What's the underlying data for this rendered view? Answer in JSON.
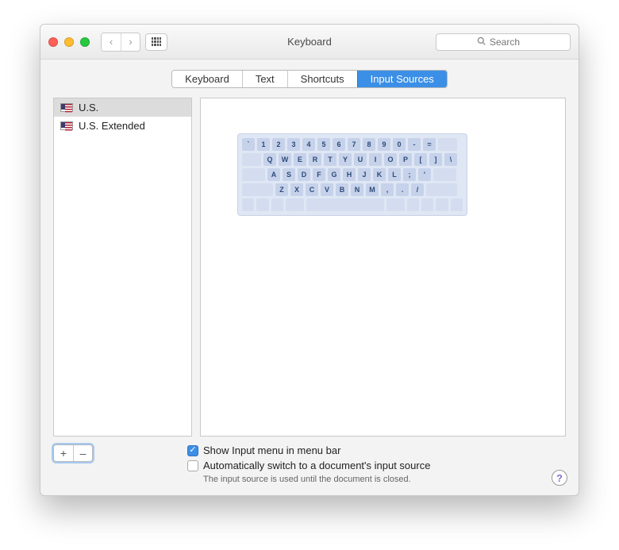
{
  "window": {
    "title": "Keyboard"
  },
  "search": {
    "placeholder": "Search"
  },
  "tabs": [
    {
      "label": "Keyboard"
    },
    {
      "label": "Text"
    },
    {
      "label": "Shortcuts"
    },
    {
      "label": "Input Sources",
      "active": true
    }
  ],
  "sources": [
    {
      "label": "U.S.",
      "selected": true
    },
    {
      "label": "U.S. Extended",
      "selected": false
    }
  ],
  "keyboard_layout": {
    "row1": [
      "`",
      "1",
      "2",
      "3",
      "4",
      "5",
      "6",
      "7",
      "8",
      "9",
      "0",
      "-",
      "="
    ],
    "row2": [
      "Q",
      "W",
      "E",
      "R",
      "T",
      "Y",
      "U",
      "I",
      "O",
      "P",
      "[",
      "]",
      "\\"
    ],
    "row3": [
      "A",
      "S",
      "D",
      "F",
      "G",
      "H",
      "J",
      "K",
      "L",
      ";",
      "'"
    ],
    "row4": [
      "Z",
      "X",
      "C",
      "V",
      "B",
      "N",
      "M",
      ",",
      ".",
      "/"
    ]
  },
  "options": {
    "show_input_menu": {
      "label": "Show Input menu in menu bar",
      "checked": true
    },
    "auto_switch": {
      "label": "Automatically switch to a document's input source",
      "checked": false
    },
    "hint": "The input source is used until the document is closed."
  },
  "buttons": {
    "add": "+",
    "remove": "–"
  },
  "help": "?"
}
